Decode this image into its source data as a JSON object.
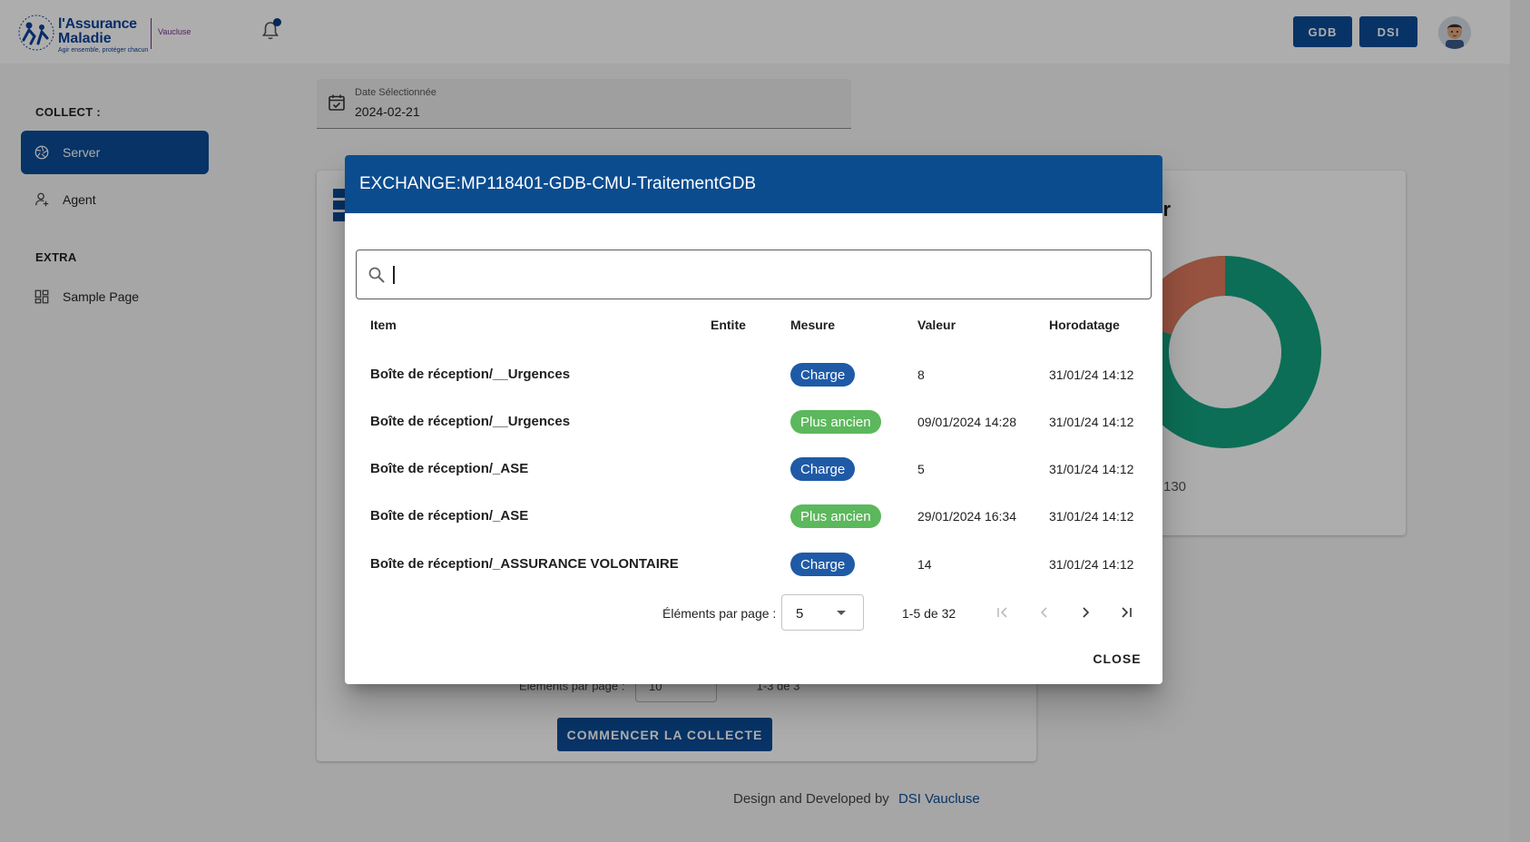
{
  "colors": {
    "primary": "#0b4c97",
    "header": "#0b4c8f",
    "chip_charge": "#1f5aa6",
    "chip_plus_ancien": "#5cb85c",
    "donut_green": "#12a37f",
    "donut_red": "#e07a5f"
  },
  "brand": {
    "line1": "l'Assurance",
    "line2": "Maladie",
    "tagline": "Agir ensemble, protéger chacun",
    "department": "Vaucluse"
  },
  "topbar": {
    "btn_gdb": "GDB",
    "btn_dsi": "DSI"
  },
  "sidebar": {
    "collect_title": "COLLECT :",
    "extra_title": "EXTRA",
    "items": [
      {
        "label": "Server",
        "icon": "aperture-icon"
      },
      {
        "label": "Agent",
        "icon": "user-add-icon"
      },
      {
        "label": "Sample Page",
        "icon": "dashboard-icon"
      }
    ]
  },
  "date_field": {
    "label": "Date Sélectionnée",
    "value": "2024-02-21"
  },
  "background": {
    "right_card_title_fragment": "ur",
    "legend_fragment": "130",
    "pager_label": "Éléments par page :",
    "pager_value": "10",
    "pager_range": "1-3 de 3",
    "start_button": "COMMENCER LA COLLECTE"
  },
  "footer": {
    "text": "Design and Developed by",
    "link": "DSI Vaucluse"
  },
  "modal": {
    "title": "EXCHANGE:MP118401-GDB-CMU-TraitementGDB",
    "search_value": "",
    "columns": [
      "Item",
      "Entite",
      "Mesure",
      "Valeur",
      "Horodatage"
    ],
    "rows": [
      {
        "item": "Boîte de réception/__Urgences",
        "entite": "",
        "mesure": "Charge",
        "valeur": "8",
        "horodatage": "31/01/24 14:12"
      },
      {
        "item": "Boîte de réception/__Urgences",
        "entite": "",
        "mesure": "Plus ancien",
        "valeur": "09/01/2024 14:28",
        "horodatage": "31/01/24 14:12"
      },
      {
        "item": "Boîte de réception/_ASE",
        "entite": "",
        "mesure": "Charge",
        "valeur": "5",
        "horodatage": "31/01/24 14:12"
      },
      {
        "item": "Boîte de réception/_ASE",
        "entite": "",
        "mesure": "Plus ancien",
        "valeur": "29/01/2024 16:34",
        "horodatage": "31/01/24 14:12"
      },
      {
        "item": "Boîte de réception/_ASSURANCE VOLONTAIRE",
        "entite": "",
        "mesure": "Charge",
        "valeur": "14",
        "horodatage": "31/01/24 14:12"
      }
    ],
    "paginator": {
      "label": "Éléments par page :",
      "page_size": "5",
      "range": "1-5 de 32"
    },
    "close_label": "CLOSE"
  }
}
